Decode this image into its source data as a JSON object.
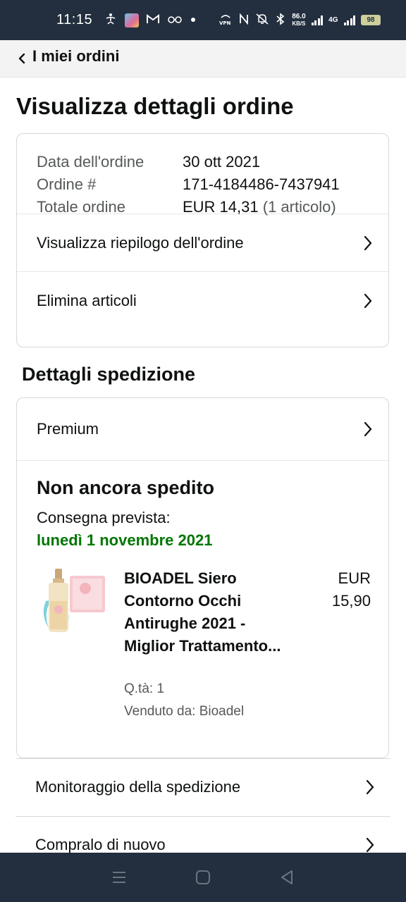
{
  "status_bar": {
    "time": "11:15",
    "speed_value": "86.0",
    "speed_unit": "KB/S",
    "network": "4G",
    "battery": "98",
    "icons": [
      "accessibility-icon",
      "photo-notification-icon",
      "gmail-icon",
      "glasses-icon",
      "dot-icon",
      "vpn-icon",
      "nfc-icon",
      "mute-icon",
      "bluetooth-icon",
      "signal-icon",
      "battery-icon"
    ]
  },
  "nav": {
    "back_label": "I miei ordini"
  },
  "page": {
    "title": "Visualizza dettagli ordine"
  },
  "order": {
    "date_label": "Data dell'ordine",
    "date_value": "30 ott 2021",
    "number_label": "Ordine #",
    "number_value": "171-4184486-7437941",
    "total_label": "Totale ordine",
    "total_value": "EUR 14,31",
    "total_items": "(1 articolo)",
    "links": [
      {
        "label": "Visualizza riepilogo dell'ordine"
      },
      {
        "label": "Elimina articoli"
      }
    ]
  },
  "shipping": {
    "section_title": "Dettagli spedizione",
    "method": "Premium",
    "status": "Non ancora spedito",
    "delivery_label": "Consegna prevista:",
    "delivery_date": "lunedì 1 novembre 2021",
    "product": {
      "title": "BIOADEL Siero Contorno Occhi Antirughe 2021 - Miglior Trattamento...",
      "price_currency": "EUR",
      "price_value": "15,90",
      "qty": "Q.tà: 1",
      "seller": "Venduto da: Bioadel"
    }
  },
  "actions": {
    "track": "Monitoraggio della spedizione",
    "buy_again": "Compralo di nuovo"
  },
  "colors": {
    "status_bar": "#232f3e",
    "delivery_green": "#007600",
    "text_primary": "#0f1111",
    "text_secondary": "#565959",
    "border": "#d5d9d9"
  }
}
